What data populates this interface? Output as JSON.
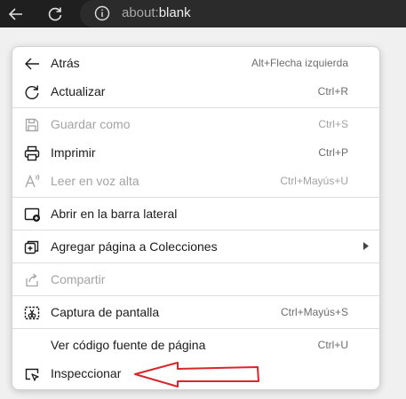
{
  "browser": {
    "address_prefix": "about:",
    "address_page": "blank",
    "back_icon": "arrow-left-icon",
    "refresh_icon": "refresh-icon",
    "info_icon": "info-icon"
  },
  "menu": {
    "items": [
      {
        "label": "Atrás",
        "shortcut": "Alt+Flecha izquierda"
      },
      {
        "label": "Actualizar",
        "shortcut": "Ctrl+R"
      },
      {
        "label": "Guardar como",
        "shortcut": "Ctrl+S"
      },
      {
        "label": "Imprimir",
        "shortcut": "Ctrl+P"
      },
      {
        "label": "Leer en voz alta",
        "shortcut": "Ctrl+Mayús+U"
      },
      {
        "label": "Abrir en la barra lateral",
        "shortcut": ""
      },
      {
        "label": "Agregar página a Colecciones",
        "shortcut": ""
      },
      {
        "label": "Compartir",
        "shortcut": ""
      },
      {
        "label": "Captura de pantalla",
        "shortcut": "Ctrl+Mayús+S"
      },
      {
        "label": "Ver código fuente de página",
        "shortcut": "Ctrl+U"
      },
      {
        "label": "Inspeccionar",
        "shortcut": ""
      }
    ]
  },
  "colors": {
    "toolbar_bg": "#1f1f1f",
    "annotation_arrow": "#d9262b",
    "disabled_text": "#a3a3a3"
  }
}
